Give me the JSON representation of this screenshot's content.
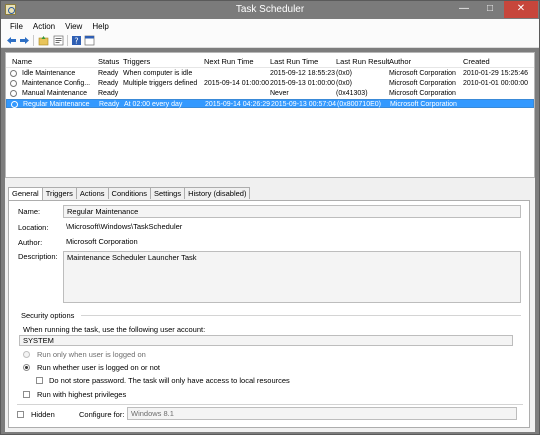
{
  "window": {
    "title": "Task Scheduler"
  },
  "menu": [
    "File",
    "Action",
    "View",
    "Help"
  ],
  "toolbar": [
    "back-arrow-icon",
    "forward-arrow-icon",
    "folder-up-icon",
    "properties-icon",
    "help-icon",
    "console-icon"
  ],
  "columns": [
    "Name",
    "Status",
    "Triggers",
    "Next Run Time",
    "Last Run Time",
    "Last Run Result",
    "Author",
    "Created"
  ],
  "rows": [
    {
      "name": "Idle Maintenance",
      "status": "Ready",
      "triggers": "When computer is idle",
      "next": "",
      "last": "2015-09-12 18:55:23",
      "result": "(0x0)",
      "author": "Microsoft Corporation",
      "created": "2010-01-29 15:25:46"
    },
    {
      "name": "Maintenance Config...",
      "status": "Ready",
      "triggers": "Multiple triggers defined",
      "next": "2015-09-14 01:00:00",
      "last": "2015-09-13 01:00:00",
      "result": "(0x0)",
      "author": "Microsoft Corporation",
      "created": "2010-01-01 00:00:00"
    },
    {
      "name": "Manual Maintenance",
      "status": "Ready",
      "triggers": "",
      "next": "",
      "last": "Never",
      "result": "(0x41303)",
      "author": "Microsoft Corporation",
      "created": ""
    },
    {
      "name": "Regular Maintenance",
      "status": "Ready",
      "triggers": "At 02:00 every day",
      "next": "2015-09-14 04:26:29",
      "last": "2015-09-13 00:57:04",
      "result": "(0x800710E0)",
      "author": "Microsoft Corporation",
      "created": ""
    }
  ],
  "selected_row": 3,
  "tabs": [
    "General",
    "Triggers",
    "Actions",
    "Conditions",
    "Settings",
    "History (disabled)"
  ],
  "general": {
    "name_label": "Name:",
    "name_value": "Regular Maintenance",
    "location_label": "Location:",
    "location_value": "\\Microsoft\\Windows\\TaskScheduler",
    "author_label": "Author:",
    "author_value": "Microsoft Corporation",
    "description_label": "Description:",
    "description_value": "Maintenance Scheduler Launcher Task",
    "security_title": "Security options",
    "account_prompt": "When running the task, use the following user account:",
    "account_value": "SYSTEM",
    "radio_logged_on": "Run only when user is logged on",
    "radio_whether": "Run whether user is logged on or not",
    "no_store_password": "Do not store password.  The task will only have access to local resources",
    "highest_privileges": "Run with highest privileges",
    "hidden": "Hidden",
    "configure_label": "Configure for:",
    "configure_value": "Windows 8.1"
  },
  "colors": {
    "selection": "#3399ff",
    "close_button": "#c7463b",
    "titlebar": "#7b7b7b"
  }
}
